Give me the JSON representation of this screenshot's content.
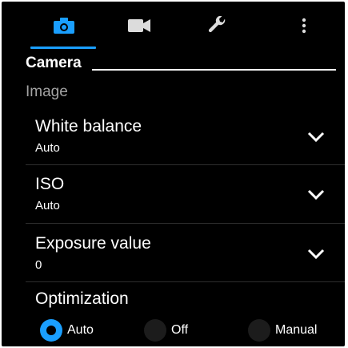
{
  "tabs": [
    {
      "icon": "camera-icon",
      "selected": true
    },
    {
      "icon": "video-icon",
      "selected": false
    },
    {
      "icon": "wrench-icon",
      "selected": false
    },
    {
      "icon": "more-vertical-icon",
      "selected": false
    }
  ],
  "section": {
    "title": "Camera",
    "subtitle": "Image"
  },
  "settings": [
    {
      "title": "White balance",
      "value": "Auto"
    },
    {
      "title": "ISO",
      "value": "Auto"
    },
    {
      "title": "Exposure value",
      "value": "0"
    }
  ],
  "optimization": {
    "title": "Optimization",
    "options": [
      "Auto",
      "Off",
      "Manual"
    ],
    "selected": "Auto"
  },
  "colors": {
    "accent": "#1a9fff",
    "background": "#000000",
    "divider": "#2e2e2e",
    "muted": "#a3a3a3"
  }
}
